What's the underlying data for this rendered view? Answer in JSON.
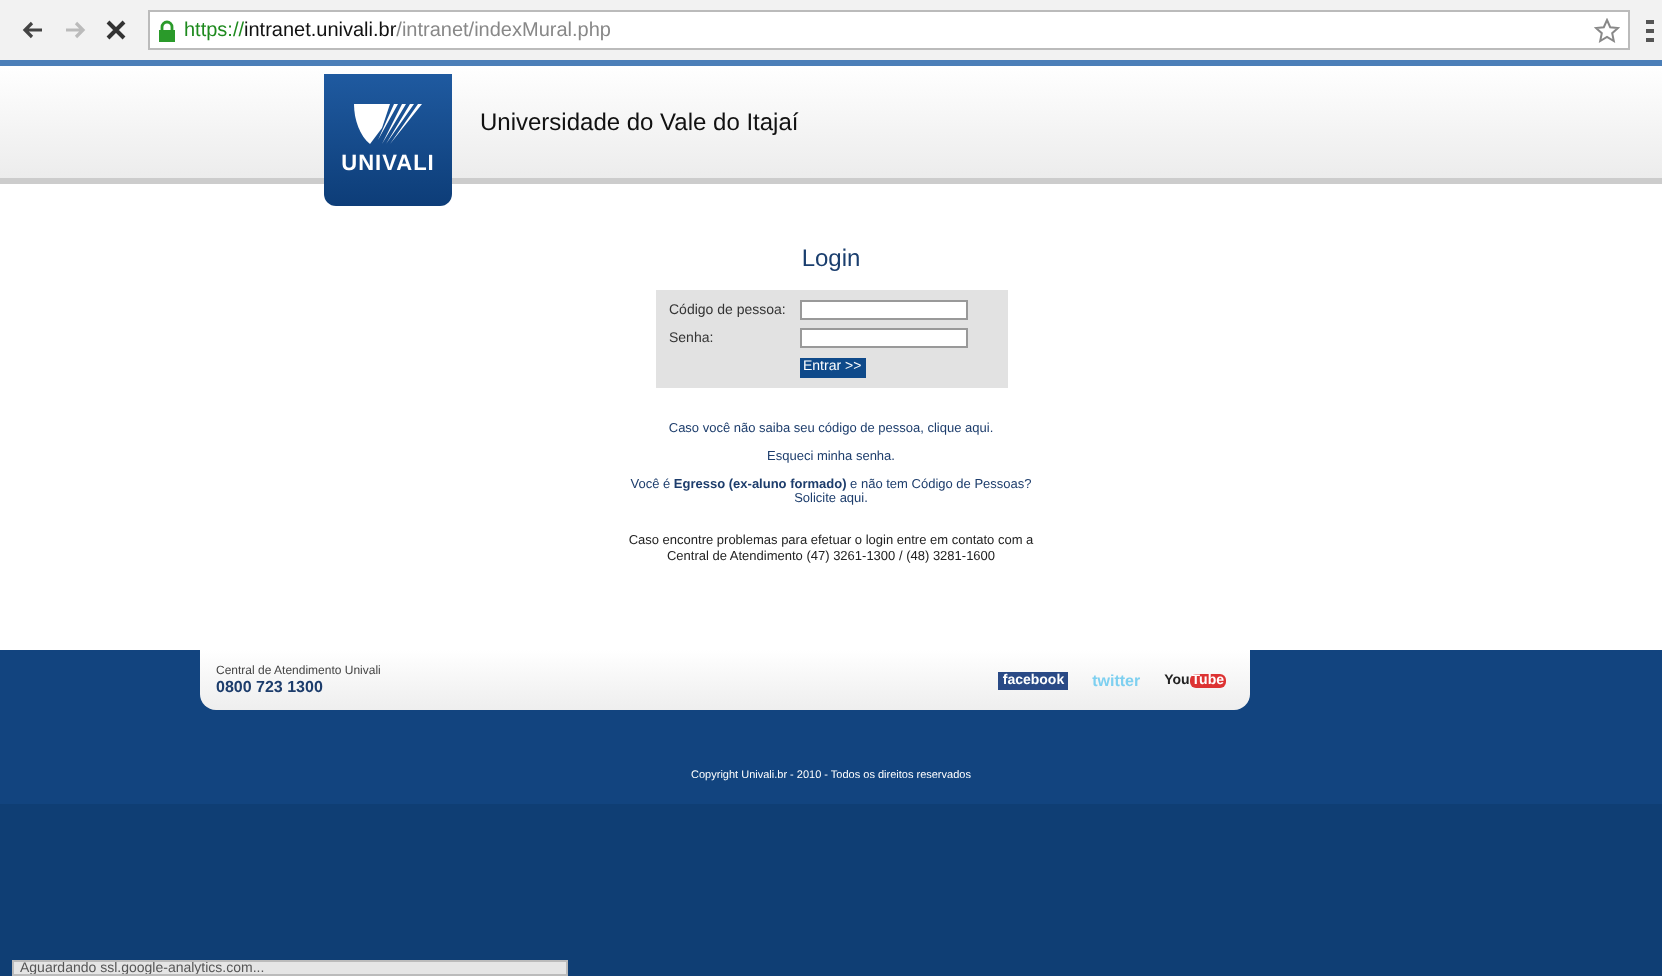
{
  "browser": {
    "url_scheme": "https://",
    "url_host": "intranet.univali.br",
    "url_path": "/intranet/indexMural.php"
  },
  "header": {
    "logo_text": "UNIVALI",
    "title": "Universidade do Vale do Itajaí"
  },
  "login": {
    "title": "Login",
    "fields": [
      {
        "label": "Código de pessoa:"
      },
      {
        "label": "Senha:"
      }
    ],
    "submit": "Entrar >>"
  },
  "help": [
    {
      "kind": "link",
      "text": "Caso você não saiba seu código de pessoa, clique aqui."
    },
    {
      "kind": "link",
      "text": "Esqueci minha senha."
    },
    {
      "kind": "link",
      "text": "Você é **Egresso (ex-aluno formado)** e não tem Código de Pessoas? Solicite aqui."
    },
    {
      "kind": "text",
      "text": "Caso encontre problemas para efetuar o login entre em contato com a Central de Atendimento (47) 3261-1300 / (48) 3281-1600"
    }
  ],
  "footer": {
    "center_label": "Central de Atendimento Univali",
    "phone": "0800 723 1300",
    "social": [
      {
        "kind": "facebook",
        "text": "facebook"
      },
      {
        "kind": "twitter",
        "text": "twitter"
      },
      {
        "kind": "youtube",
        "text": "You",
        "text2": "Tube"
      }
    ],
    "copyright": "Copyright Univali.br - 2010 - Todos os direitos reservados"
  },
  "status_bar": "Aguardando ssl.google-analytics.com..."
}
